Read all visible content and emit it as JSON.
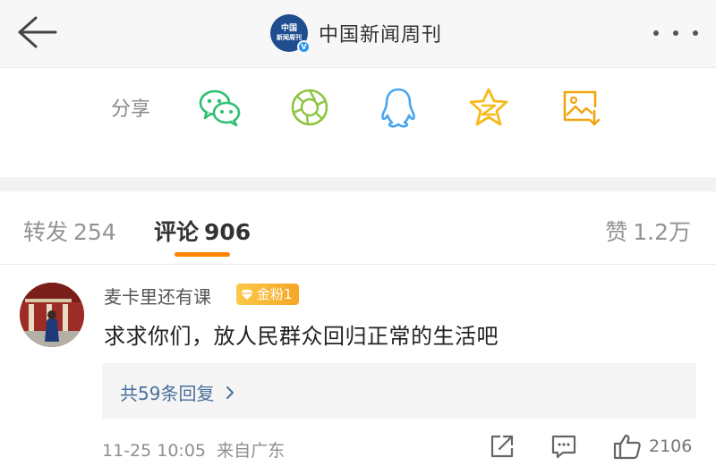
{
  "header": {
    "account_name": "中国新闻周刊",
    "logo_text": [
      "中国",
      "新闻周刊"
    ],
    "verified_mark": "V"
  },
  "share": {
    "label": "分享",
    "targets": [
      "wechat-icon",
      "moments-icon",
      "qq-icon",
      "qzone-icon",
      "save-image-icon"
    ]
  },
  "tabs": {
    "repost": {
      "label": "转发",
      "count": "254"
    },
    "comment": {
      "label": "评论",
      "count": "906"
    },
    "like": {
      "label": "赞",
      "count": "1.2万"
    }
  },
  "comment": {
    "username": "麦卡里还有课",
    "fan_badge": "金粉1",
    "text": "求求你们，放人民群众回归正常的生活吧",
    "replies_link": "共59条回复",
    "timestamp": "11-25 10:05",
    "location": "来自广东",
    "like_count": "2106"
  },
  "colors": {
    "accent": "#ff8200",
    "link": "#4a6f9c",
    "wechat": "#2fbf71",
    "qq": "#4aa6f0",
    "qzone": "#f5bb1c",
    "save": "#f0a50d"
  }
}
